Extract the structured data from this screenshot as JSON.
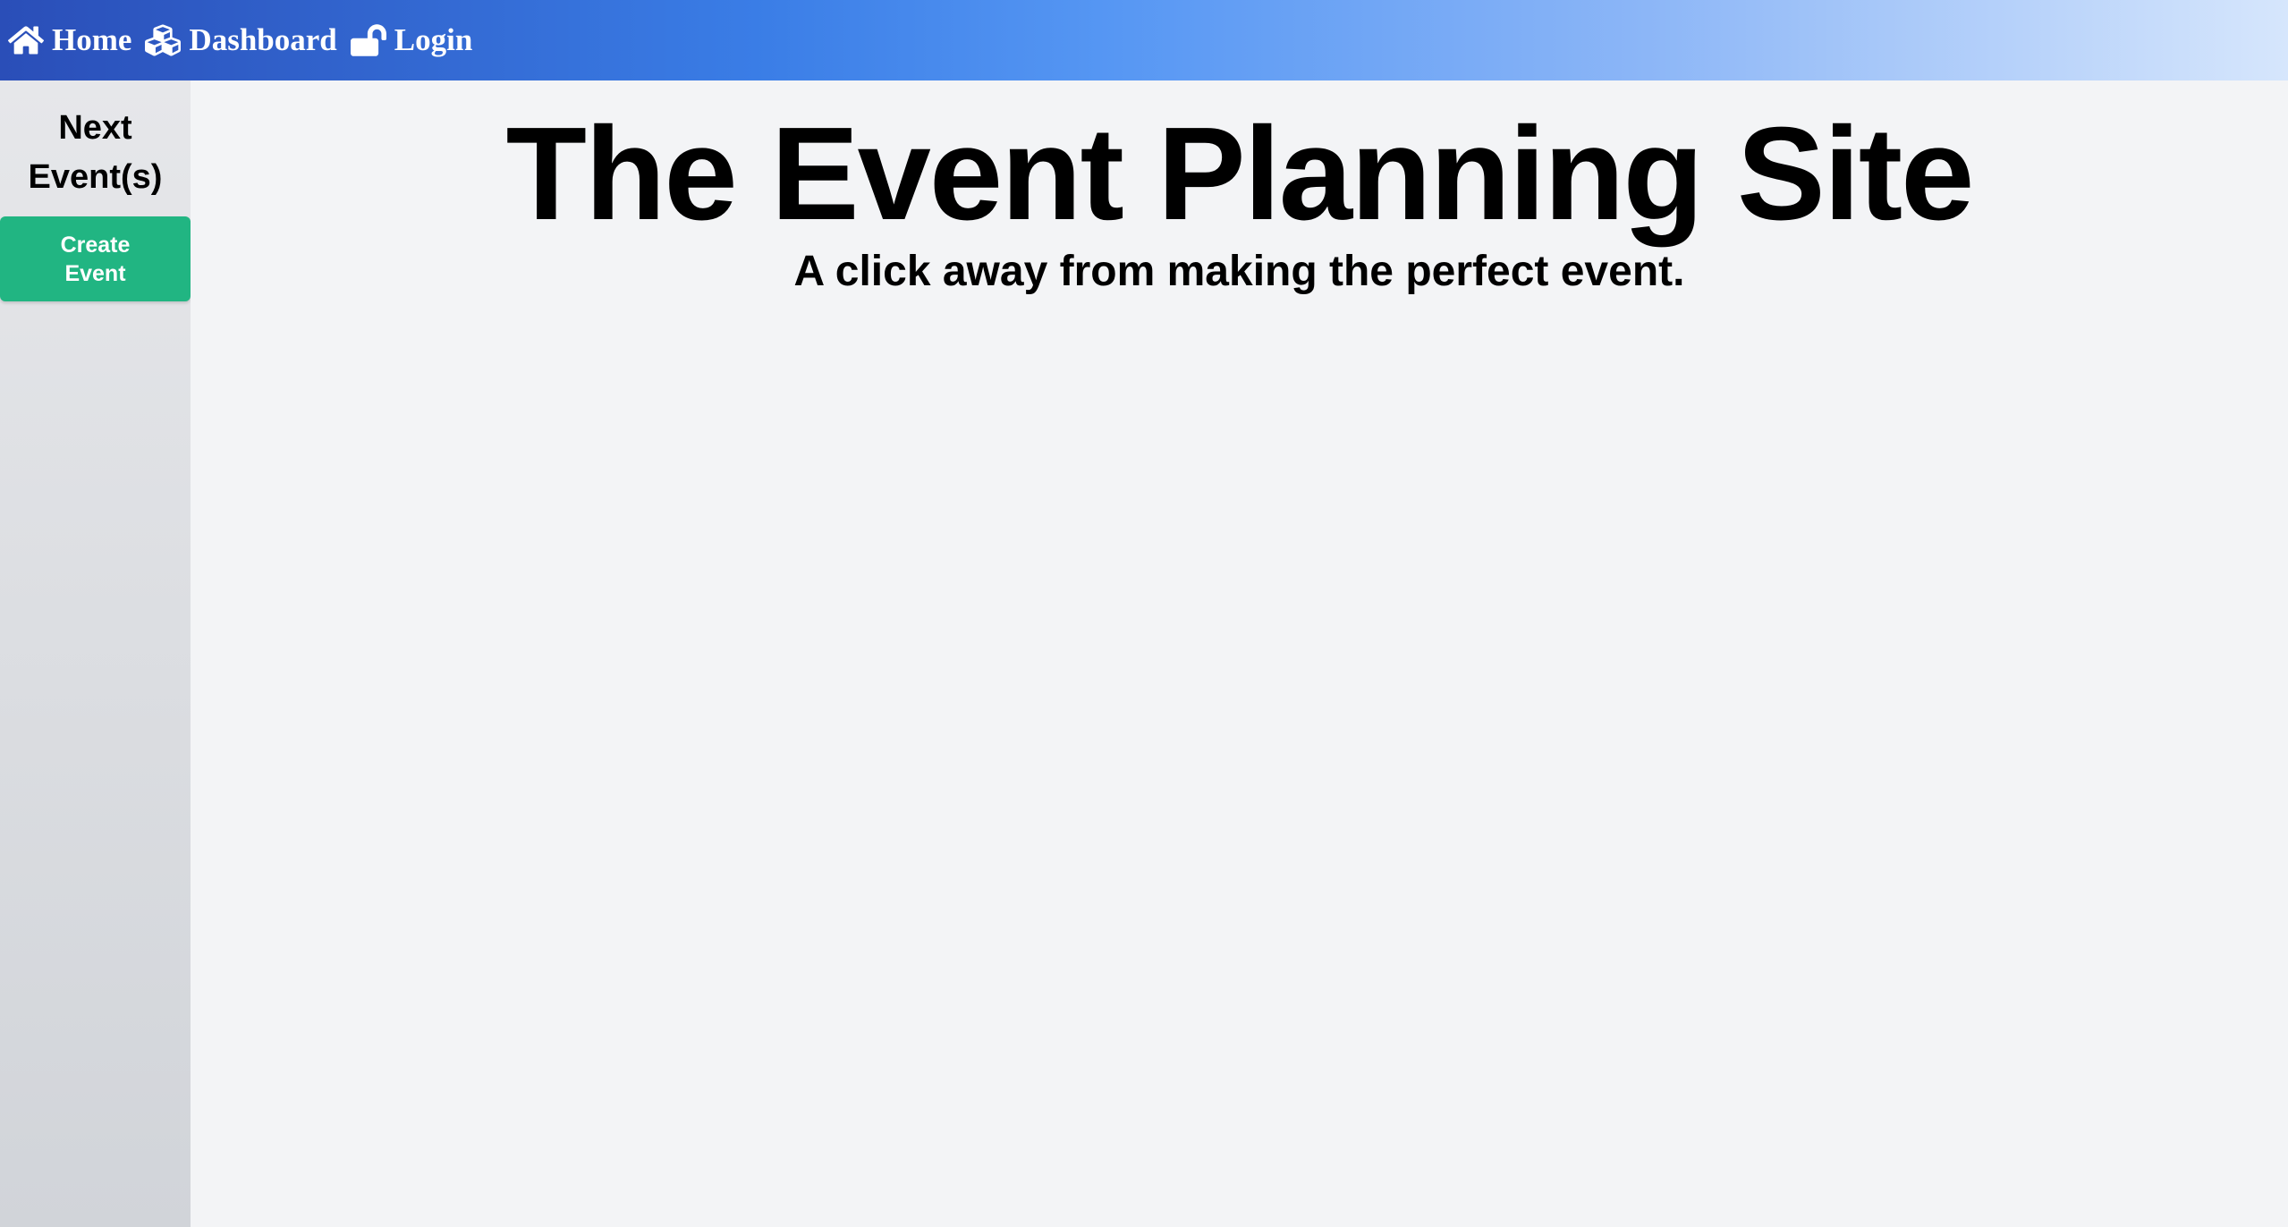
{
  "nav": {
    "items": [
      {
        "label": "Home",
        "icon": "home-icon"
      },
      {
        "label": "Dashboard",
        "icon": "cubes-icon"
      },
      {
        "label": "Login",
        "icon": "unlock-icon"
      }
    ]
  },
  "sidebar": {
    "title": "Next Event(s)",
    "create_button": "Create Event"
  },
  "main": {
    "title": "The Event Planning Site",
    "subtitle": "A click away from making the perfect event."
  },
  "colors": {
    "create_button": "#21b582",
    "nav_gradient_start": "#2a4eb8",
    "nav_gradient_end": "#d6e6fc"
  }
}
